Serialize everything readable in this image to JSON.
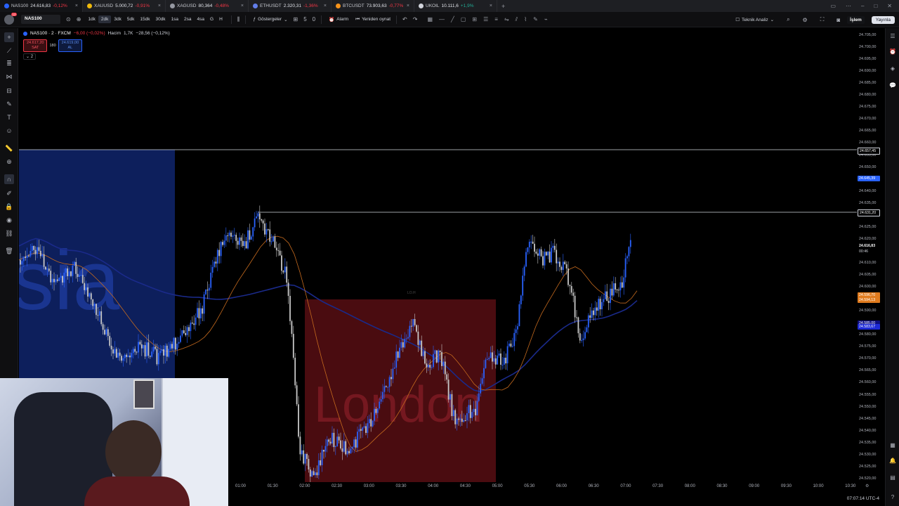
{
  "tabs": [
    {
      "symbol": "NAS100",
      "price": "24.616,83",
      "change": "-0,12%",
      "dir": "down",
      "color": "#2962ff"
    },
    {
      "symbol": "XAUUSD",
      "price": "5.000,72",
      "change": "-0,91%",
      "dir": "down",
      "color": "#f0b90b"
    },
    {
      "symbol": "XAGUSD",
      "price": "80,364",
      "change": "-0,48%",
      "dir": "down",
      "color": "#9598a1"
    },
    {
      "symbol": "ETHUSDT",
      "price": "2.320,31",
      "change": "-1,36%",
      "dir": "down",
      "color": "#627eea"
    },
    {
      "symbol": "BTCUSDT",
      "price": "73.903,63",
      "change": "-0,77%",
      "dir": "down",
      "color": "#f7931a"
    },
    {
      "symbol": "UKOIL",
      "price": "10.111,6",
      "change": "+1,9%",
      "dir": "up",
      "color": "#d1d4dc"
    }
  ],
  "toolbar": {
    "symbol": "NAS100",
    "logo_badge": "12",
    "intervals": [
      "1dk",
      "2dk",
      "3dk",
      "5dk",
      "15dk",
      "30dk",
      "1sa",
      "2sa",
      "4sa",
      "G",
      "H"
    ],
    "selected_interval": "2dk",
    "indicators_label": "Göstergeler",
    "alarm_label": "Alarm",
    "replay_label": "Yeniden oynat",
    "layout_label": "Teknik Analiz",
    "trade_label": "İşlem",
    "publish_label": "Yayınla",
    "counter_a": "5",
    "counter_b": "0"
  },
  "legend": {
    "symbol": "NAS100 · 2 · FXCM",
    "change": "−6,00 (−0,02%)",
    "volume_label": "Hacim",
    "volume_value": "1,7K",
    "volume_change": "−28,56 (−0,12%)",
    "sell_price": "24.617,20",
    "sell_label": "SAT",
    "spread": "180",
    "buy_price": "24.619,00",
    "buy_label": "AL",
    "collapse": "2"
  },
  "sessions": {
    "asia": "sia",
    "london": "London",
    "london_small": "LO.H"
  },
  "price_axis": {
    "ticks": [
      "24.705,00",
      "24.700,00",
      "24.695,00",
      "24.690,00",
      "24.685,00",
      "24.680,00",
      "24.675,00",
      "24.670,00",
      "24.665,00",
      "24.660,00",
      "24.655,00",
      "24.650,00",
      "24.645,00",
      "24.640,00",
      "24.635,00",
      "24.630,00",
      "24.625,00",
      "24.620,00",
      "24.615,00",
      "24.610,00",
      "24.605,00",
      "24.600,00",
      "24.595,00",
      "24.590,00",
      "24.585,00",
      "24.580,00",
      "24.575,00",
      "24.570,00",
      "24.565,00",
      "24.560,00",
      "24.555,00",
      "24.550,00",
      "24.545,00",
      "24.540,00",
      "24.535,00",
      "24.530,00",
      "24.525,00",
      "24.520,00"
    ],
    "tag_high": "24.657,45",
    "tag_blue": "24.645,39",
    "tag_line2": "24.631,20",
    "tag_current": "24.616,83",
    "tag_countdown": "00:46",
    "tag_orange": "24.596,70",
    "tag_orange2": "24.594,13",
    "tag_blue2": "24.585,00",
    "tag_blue3": "24.583,67"
  },
  "time_axis": [
    "01:00",
    "01:30",
    "02:00",
    "02:30",
    "03:00",
    "03:30",
    "04:00",
    "04:30",
    "05:00",
    "05:30",
    "06:00",
    "06:30",
    "07:00",
    "07:30",
    "08:00",
    "08:30",
    "09:00",
    "09:30",
    "10:00",
    "10:30"
  ],
  "status": {
    "clock": "07:07:14 UTC-4"
  },
  "colors": {
    "asia_box": "#0d1f5c",
    "london_box": "#4a0c10",
    "up_candle": "#2962ff",
    "down_candle": "#c8c8c8",
    "orange_ma": "#c56a1e",
    "blue_ma": "#1a2a8a"
  },
  "icons": {
    "tab_close": "×",
    "tab_add": "+"
  }
}
